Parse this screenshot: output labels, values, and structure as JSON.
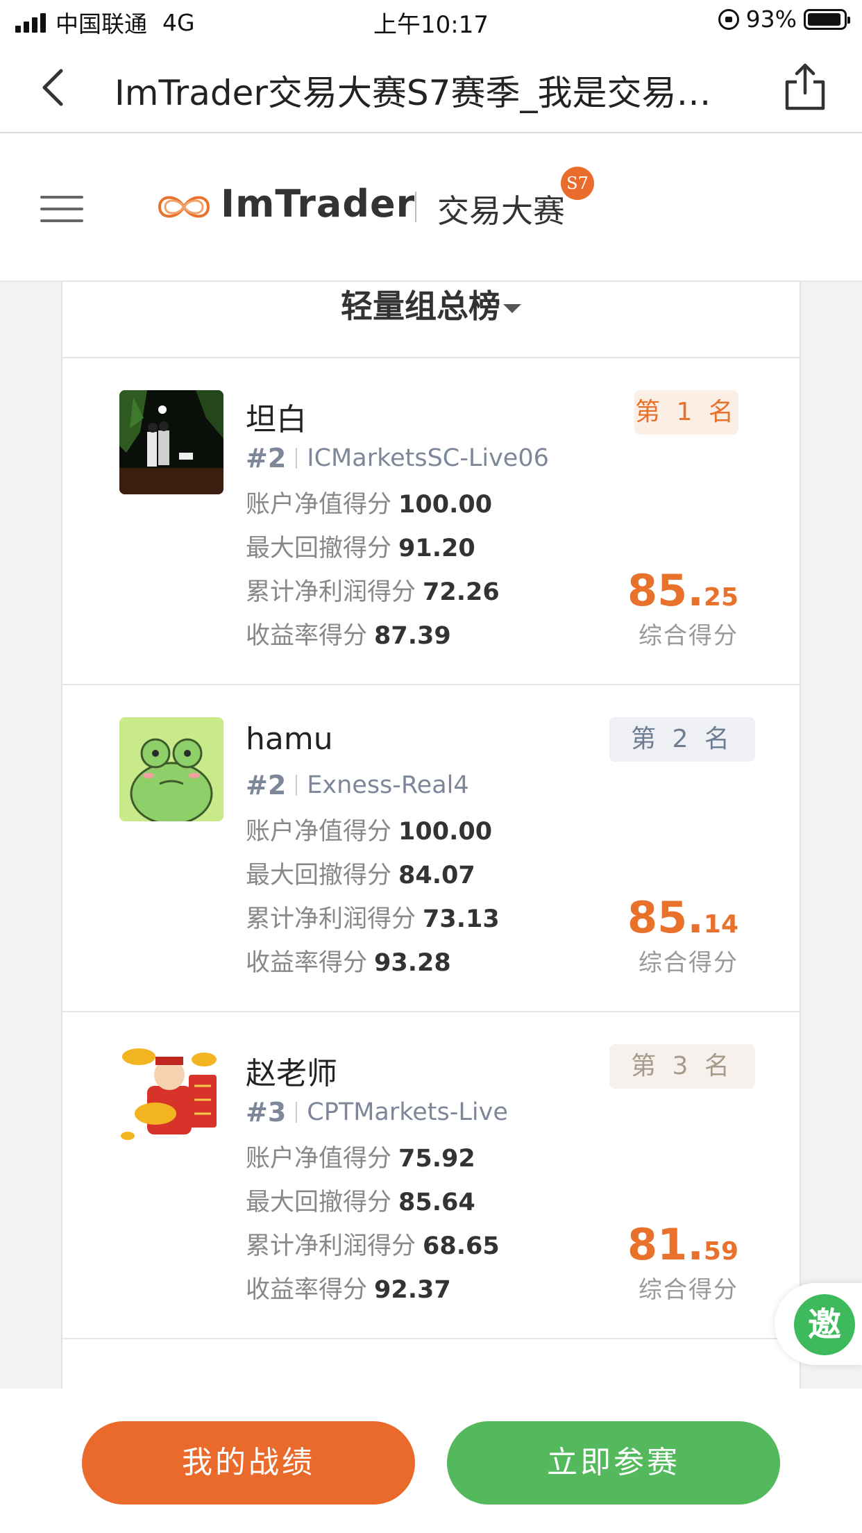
{
  "status_bar": {
    "carrier": "中国联通",
    "network": "4G",
    "time": "上午10:17",
    "battery": "93%",
    "battery_level": 0.93
  },
  "nav": {
    "title": "ImTrader交易大赛S7赛季_我是交易…"
  },
  "brand": {
    "name": "ImTrader",
    "subtitle": "交易大赛",
    "season_badge": "S7"
  },
  "board": {
    "title": "轻量组总榜"
  },
  "labels": {
    "equity": "账户净值得分",
    "drawdown": "最大回撤得分",
    "profit": "累计净利润得分",
    "return": "收益率得分",
    "score_caption": "综合得分"
  },
  "entries": [
    {
      "name": "坦白",
      "index": "#2",
      "broker": "ICMarketsSC-Live06",
      "rank": "第 1 名",
      "equity": "100.00",
      "drawdown": "91.20",
      "profit": "72.26",
      "return": "87.39",
      "score_int": "85.",
      "score_dec": "25"
    },
    {
      "name": "hamu",
      "index": "#2",
      "broker": "Exness-Real4",
      "rank": "第 2 名",
      "equity": "100.00",
      "drawdown": "84.07",
      "profit": "73.13",
      "return": "93.28",
      "score_int": "85.",
      "score_dec": "14"
    },
    {
      "name": "赵老师",
      "index": "#3",
      "broker": "CPTMarkets-Live",
      "rank": "第 3 名",
      "equity": "75.92",
      "drawdown": "85.64",
      "profit": "68.65",
      "return": "92.37",
      "score_int": "81.",
      "score_dec": "59"
    }
  ],
  "invite": {
    "label": "邀"
  },
  "actions": {
    "my_record": "我的战绩",
    "join_now": "立即参赛"
  },
  "colors": {
    "accent_orange": "#e8712c",
    "accent_green": "#53b95c"
  }
}
